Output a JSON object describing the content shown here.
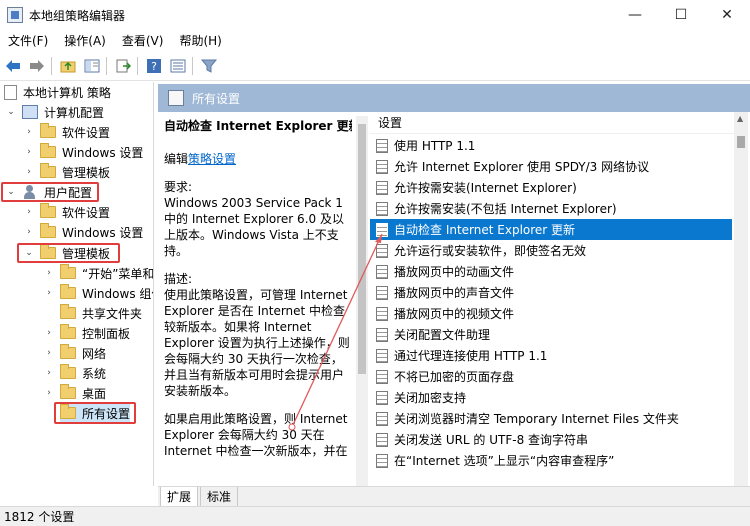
{
  "window": {
    "title": "本地组策略编辑器",
    "minimize_glyph": "—",
    "maximize_glyph": "☐",
    "close_glyph": "✕"
  },
  "menu": [
    "文件(F)",
    "操作(A)",
    "查看(V)",
    "帮助(H)"
  ],
  "toolbar": {
    "icons": [
      "back-arrow-icon",
      "forward-arrow-icon",
      "up-folder-icon",
      "show-hide-tree-icon",
      "export-list-icon",
      "help-icon",
      "properties-view-icon",
      "filter-icon"
    ]
  },
  "tree": {
    "root": "本地计算机 策略",
    "computer_config": "计算机配置",
    "computer_children": [
      "软件设置",
      "Windows 设置",
      "管理模板"
    ],
    "user_config": "用户配置",
    "user_children": [
      "软件设置",
      "Windows 设置",
      "管理模板"
    ],
    "admin_templates_children": [
      "“开始”菜单和",
      "Windows 组件",
      "共享文件夹",
      "控制面板",
      "网络",
      "系统",
      "桌面",
      "所有设置"
    ]
  },
  "content": {
    "header": "所有设置",
    "description": {
      "title": "自动检查 Internet Explorer 更新",
      "edit_prefix": "编辑",
      "edit_link": "策略设置",
      "requirements_label": "要求:",
      "requirements_text": "Windows 2003 Service Pack 1 中的 Internet Explorer 6.0 及以上版本。Windows Vista 上不支持。",
      "desc_label": "描述:",
      "desc_text": "使用此策略设置，可管理 Internet Explorer 是否在 Internet 中检查较新版本。如果将 Internet Explorer 设置为执行上述操作，则会每隔大约 30 天执行一次检查，并且当有新版本可用时会提示用户安装新版本。",
      "desc_text2": "如果启用此策略设置，则 Internet Explorer 会每隔大约 30 天在 Internet 中检查一次新版本，并在"
    },
    "list_header": "设置",
    "settings": [
      "使用 HTTP 1.1",
      "允许 Internet Explorer 使用 SPDY/3 网络协议",
      "允许按需安装(Internet Explorer)",
      "允许按需安装(不包括 Internet Explorer)",
      "自动检查 Internet Explorer 更新",
      "允许运行或安装软件，即使签名无效",
      "播放网页中的动画文件",
      "播放网页中的声音文件",
      "播放网页中的视频文件",
      "关闭配置文件助理",
      "通过代理连接使用 HTTP 1.1",
      "不将已加密的页面存盘",
      "关闭加密支持",
      "关闭浏览器时清空 Temporary Internet Files 文件夹",
      "关闭发送 URL 的 UTF-8 查询字符串",
      "在“Internet 选项”上显示“内容审查程序”"
    ],
    "selected_index": 4
  },
  "tabs": [
    "扩展",
    "标准"
  ],
  "status": "1812 个设置",
  "colors": {
    "header_bg": "#9eb8d6",
    "selection": "#0b78d0",
    "highlight_red": "#e13d3d",
    "link": "#0066cc"
  }
}
